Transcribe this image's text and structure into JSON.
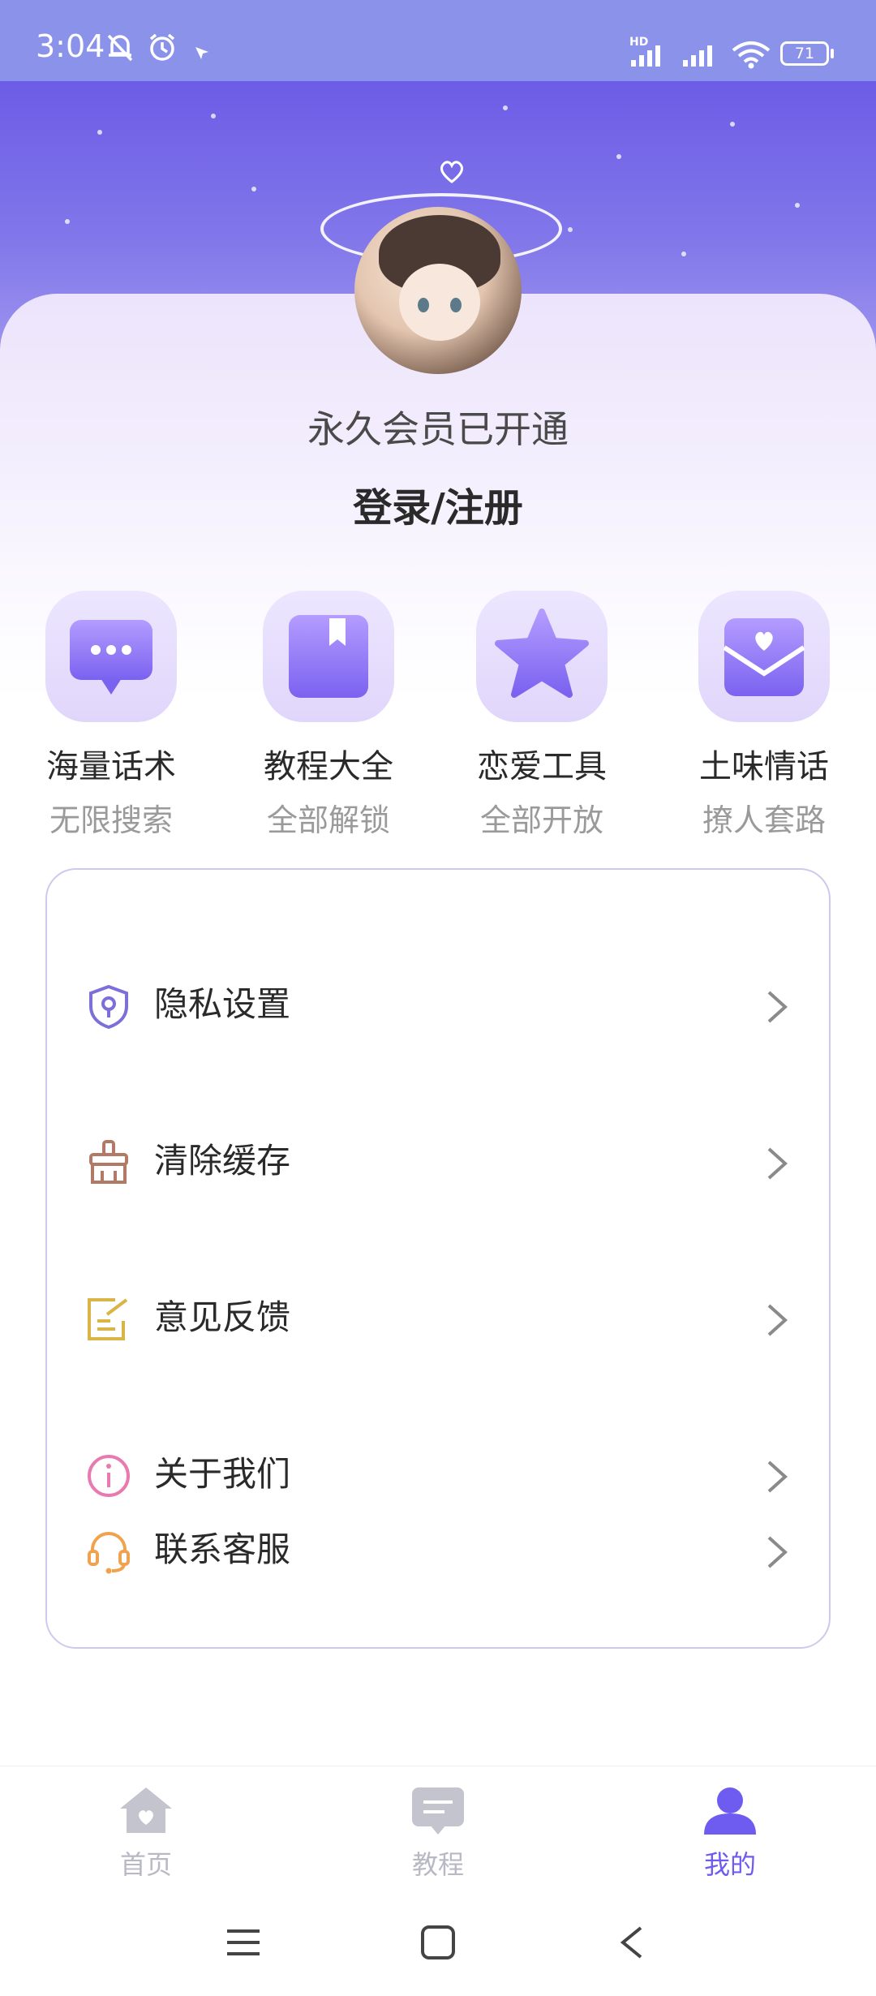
{
  "status": {
    "time": "3:04",
    "hd": "HD",
    "battery": "71"
  },
  "profile": {
    "membership": "永久会员已开通",
    "login": "登录/注册"
  },
  "features": [
    {
      "title": "海量话术",
      "subtitle": "无限搜索",
      "icon": "chat-bubble-icon"
    },
    {
      "title": "教程大全",
      "subtitle": "全部解锁",
      "icon": "book-icon"
    },
    {
      "title": "恋爱工具",
      "subtitle": "全部开放",
      "icon": "star-icon"
    },
    {
      "title": "土味情话",
      "subtitle": "撩人套路",
      "icon": "love-letter-icon"
    }
  ],
  "menu": [
    {
      "label": "隐私设置",
      "icon": "shield-lock-icon"
    },
    {
      "label": "清除缓存",
      "icon": "broom-icon"
    },
    {
      "label": "意见反馈",
      "icon": "edit-note-icon"
    },
    {
      "label": "关于我们",
      "icon": "info-icon"
    },
    {
      "label": "联系客服",
      "icon": "headset-icon"
    }
  ],
  "tabs": [
    {
      "label": "首页",
      "icon": "home-icon",
      "active": false
    },
    {
      "label": "教程",
      "icon": "message-icon",
      "active": false
    },
    {
      "label": "我的",
      "icon": "user-icon",
      "active": true
    }
  ],
  "colors": {
    "accent": "#6e5cf0",
    "inactive_tab": "#b9b9c6",
    "menu_border": "#cfc9ee"
  }
}
